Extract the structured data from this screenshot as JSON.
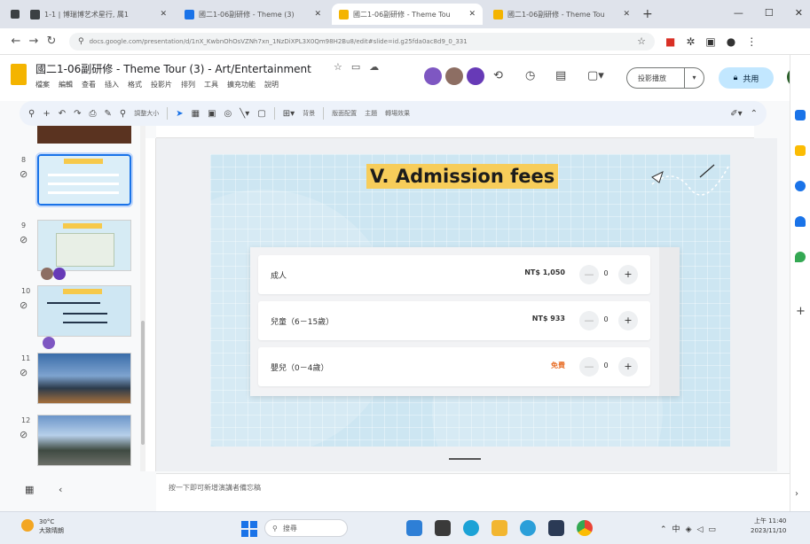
{
  "browser": {
    "tabs": [
      {
        "title": "1-1 | 博瑞博艺术星行, 属1",
        "active": false,
        "color": "#3c4043"
      },
      {
        "title": "國二1-06副研修 - Theme (3)",
        "active": false,
        "color": "#1a73e8"
      },
      {
        "title": "國二1-06副研修 - Theme Tou",
        "active": true,
        "color": "#f4b400"
      },
      {
        "title": "國二1-06副研修 - Theme Tou",
        "active": false,
        "color": "#f4b400"
      }
    ],
    "url": "docs.google.com/presentation/d/1nX_KwbnOhOsVZNh7xn_1NzDiXPL3X0Qm98H2Bu8/edit#slide=id.g25fda0ac8d9_0_331",
    "window_buttons": [
      "—",
      "☐",
      "✕"
    ]
  },
  "app": {
    "doc_title": "國二1-06副研修 - Theme Tour (3) - Art/Entertainment",
    "menu": [
      "檔案",
      "編輯",
      "查看",
      "插入",
      "格式",
      "投影片",
      "排列",
      "工具",
      "擴充功能",
      "說明"
    ],
    "slideshow_label": "投影播放",
    "share_label": "共用"
  },
  "toolbar": {
    "zoom_label": "調整大小",
    "background_label": "背景",
    "layout_label": "版面配置",
    "theme_label": "主題",
    "transition_label": "轉場效果"
  },
  "filmstrip": {
    "slides": [
      {
        "number": "8"
      },
      {
        "number": "9"
      },
      {
        "number": "10"
      },
      {
        "number": "11"
      },
      {
        "number": "12"
      }
    ]
  },
  "slide": {
    "title": "V. Admission fees",
    "tickets": [
      {
        "label": "成人",
        "price": "NT$ 1,050",
        "qty": "0",
        "free": false
      },
      {
        "label": "兒童（6－15歲）",
        "price": "NT$ 933",
        "qty": "0",
        "free": false
      },
      {
        "label": "嬰兒（0－4歲）",
        "price": "免費",
        "qty": "0",
        "free": true
      }
    ],
    "minus": "—",
    "plus": "+"
  },
  "notes": {
    "placeholder": "按一下即可新增演講者備忘稿"
  },
  "taskbar": {
    "weather_temp": "30°C",
    "weather_desc": "大致晴朗",
    "search_label": "搜尋",
    "time": "上午 11:40",
    "date": "2023/11/10"
  },
  "colors": {
    "accent": "#1a73e8",
    "slide_bg": "#cde6f2",
    "title_highlight": "#f7cd5a",
    "free_price": "#e8702a"
  }
}
